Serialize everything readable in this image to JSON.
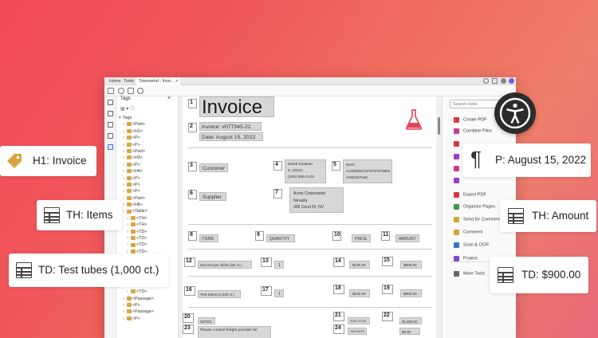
{
  "colors": {
    "background_start": "#f24a58",
    "background_end": "#e86a7b",
    "tag_chip": "#d7d7d7",
    "tag_icon": "#d9a441",
    "accent_pink": "#e0445a",
    "acrobat_red": "#d7373f"
  },
  "window": {
    "tabs": [
      {
        "label": "Home"
      },
      {
        "label": "Tools"
      },
      {
        "label": "Townsend - Invo..."
      }
    ],
    "tab_close": "×"
  },
  "tags_panel": {
    "title": "Tags",
    "close": "×",
    "options": "▤ ▾  ⓘ",
    "tree": [
      {
        "chev": "▾",
        "label": "Tags",
        "indent": 0,
        "tag": false
      },
      {
        "chev": "›",
        "label": "<Part>",
        "indent": 1,
        "tag": true
      },
      {
        "chev": "›",
        "label": "<H1>",
        "indent": 1,
        "tag": true
      },
      {
        "chev": "›",
        "label": "<P>",
        "indent": 1,
        "tag": true
      },
      {
        "chev": "›",
        "label": "<P>",
        "indent": 1,
        "tag": true
      },
      {
        "chev": "›",
        "label": "<Part>",
        "indent": 1,
        "tag": true
      },
      {
        "chev": "›",
        "label": "<H3>",
        "indent": 1,
        "tag": true
      },
      {
        "chev": "›",
        "label": "<P>",
        "indent": 1,
        "tag": true
      },
      {
        "chev": "›",
        "label": "<H4>",
        "indent": 1,
        "tag": true
      },
      {
        "chev": "›",
        "label": "<P>",
        "indent": 1,
        "tag": true
      },
      {
        "chev": "›",
        "label": "<P>",
        "indent": 1,
        "tag": true
      },
      {
        "chev": "›",
        "label": "<P>",
        "indent": 1,
        "tag": true
      },
      {
        "chev": "›",
        "label": "<Part>",
        "indent": 1,
        "tag": true
      },
      {
        "chev": "›",
        "label": "<H6>",
        "indent": 1,
        "tag": true
      },
      {
        "chev": "›",
        "label": "<Table>",
        "indent": 1,
        "tag": true
      },
      {
        "chev": "›",
        "label": "<TH>",
        "indent": 2,
        "tag": true
      },
      {
        "chev": "›",
        "label": "<TH>",
        "indent": 2,
        "tag": true
      },
      {
        "chev": "›",
        "label": "<TD>",
        "indent": 2,
        "tag": true
      },
      {
        "chev": "›",
        "label": "<TD>",
        "indent": 2,
        "tag": true
      },
      {
        "chev": "›",
        "label": "<TD>",
        "indent": 2,
        "tag": true
      },
      {
        "chev": "›",
        "label": "<TD>",
        "indent": 2,
        "tag": true
      },
      {
        "chev": "›",
        "label": "<TD>",
        "indent": 2,
        "tag": true
      },
      {
        "chev": "›",
        "label": "<TD>",
        "indent": 2,
        "tag": true
      },
      {
        "chev": "›",
        "label": "<TD>",
        "indent": 2,
        "tag": true
      },
      {
        "chev": "›",
        "label": "<TD>",
        "indent": 2,
        "tag": true
      },
      {
        "chev": "›",
        "label": "<TD>",
        "indent": 2,
        "tag": true
      },
      {
        "chev": "›",
        "label": "<TD>",
        "indent": 2,
        "tag": true
      },
      {
        "chev": "›",
        "label": "<Passage>",
        "indent": 1,
        "tag": true
      },
      {
        "chev": "›",
        "label": "<P>",
        "indent": 1,
        "tag": true
      },
      {
        "chev": "›",
        "label": "<Passage>",
        "indent": 1,
        "tag": true
      },
      {
        "chev": "›",
        "label": "<P>",
        "indent": 1,
        "tag": true
      }
    ]
  },
  "document": {
    "markers": {
      "m1": "1",
      "m2": "2",
      "m3": "3",
      "m4": "4",
      "m5": "5",
      "m6": "6",
      "m7": "7",
      "m8": "8",
      "m9": "9",
      "m10": "10",
      "m11": "11",
      "m12": "12",
      "m13": "13",
      "m14": "14",
      "m15": "15",
      "m16": "16",
      "m17": "17",
      "m18": "18",
      "m19": "19",
      "m20": "20",
      "m21": "21",
      "m22": "22",
      "m23": "23",
      "m24": "24"
    },
    "title": "Invoice",
    "invoice_number": "Invoice: #077345-22",
    "date": "Date: August 15, 2022",
    "customer_label": "Customer",
    "customer_lines": [
      "David Kassuer",
      "IL 40123",
      "(345) 555-0123"
    ],
    "iban_lines": [
      "IBAN",
      "AL09090071075787079904",
      "VHB0107648"
    ],
    "supplier_label": "Supplier",
    "supplier_lines": [
      "Acme Corporation",
      "Nevada",
      "305 Court Dr, NV"
    ],
    "headers": {
      "items": "ITEMS",
      "quantity": "QUANTITY",
      "price": "PRICE",
      "amount": "AMOUNT"
    },
    "row1": {
      "item": "Microscope slides (50 ct.)",
      "qty": "1",
      "price": "$100.00",
      "amount": "$900.00"
    },
    "row2": {
      "item": "Test tubes (1,000 ct.)",
      "qty": "1",
      "price": "$100.00",
      "amount": "$900.00"
    },
    "notes": "NOTES",
    "note_text": "Please contact freight provider for",
    "subtotal_label": "SUB-TOTAL",
    "subtotal_value": "$1,800.00",
    "tax_label": "TAX RATE",
    "tax_value": "$0.00"
  },
  "tools": {
    "search_placeholder": "Search tools",
    "items": [
      {
        "label": "Create PDF",
        "color": "#d7373f"
      },
      {
        "label": "Combine Files",
        "color": "#c83c8e"
      },
      {
        "label": "",
        "color": "#d7373f"
      },
      {
        "label": "",
        "color": "#9b3fc8"
      },
      {
        "label": "",
        "color": "#c83c8e"
      },
      {
        "label": "",
        "color": "#9b3fc8"
      },
      {
        "label": "Export PDF",
        "color": "#d7373f"
      },
      {
        "label": "Organize Pages",
        "color": "#3b9c4a"
      },
      {
        "label": "Send for Comments",
        "color": "#d7a43b"
      },
      {
        "label": "Comment",
        "color": "#d7a43b"
      },
      {
        "label": "Scan & OCR",
        "color": "#3b6fd7"
      },
      {
        "label": "Protect",
        "color": "#7e4cc8"
      },
      {
        "label": "More Tools",
        "color": "#666666"
      }
    ]
  },
  "callouts": {
    "h1": "H1: Invoice",
    "th_items": "TH: Items",
    "td_test_tubes": "TD: Test tubes (1,000 ct.)",
    "p_date": "P: August 15, 2022",
    "th_amount": "TH: Amount",
    "td_amount": "TD: $900.00",
    "pilcrow": "¶"
  }
}
